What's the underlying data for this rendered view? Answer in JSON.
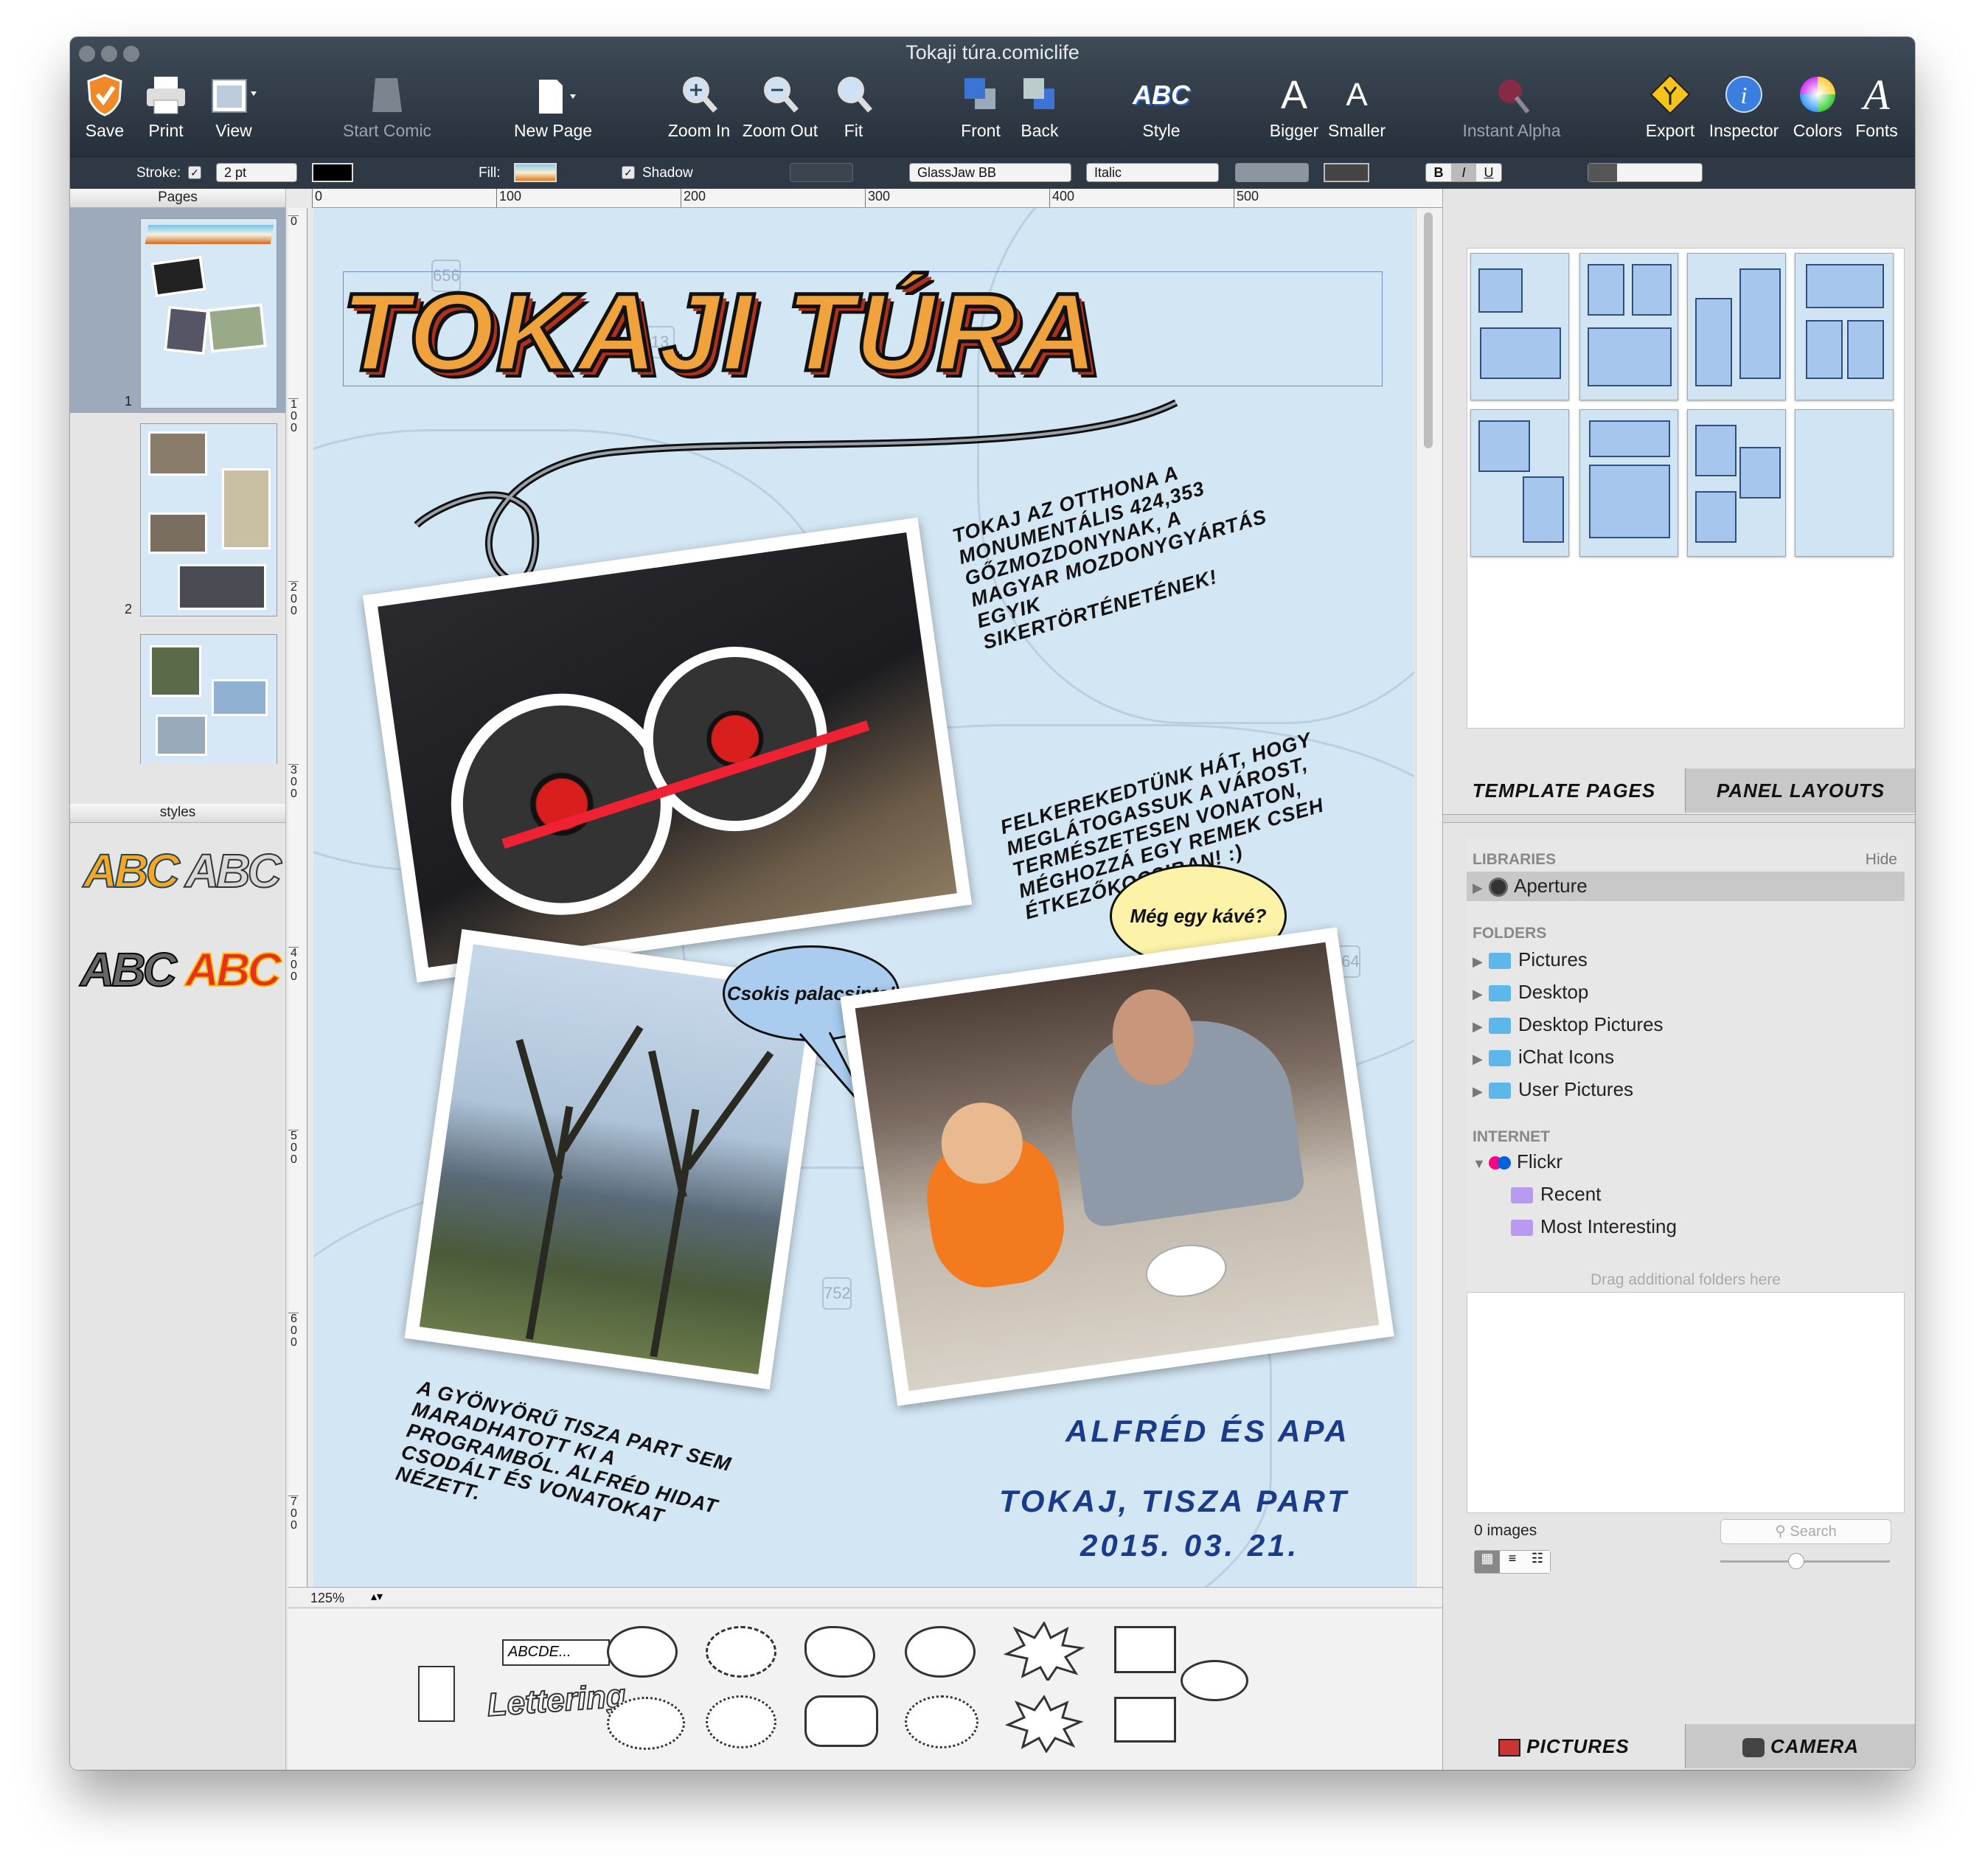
{
  "window": {
    "title": "Tokaji túra.comiclife"
  },
  "toolbar": {
    "save": "Save",
    "print": "Print",
    "view": "View",
    "start_comic": "Start Comic",
    "new_page": "New Page",
    "zoom_in": "Zoom In",
    "zoom_out": "Zoom Out",
    "fit": "Fit",
    "front": "Front",
    "back": "Back",
    "style": "Style",
    "bigger": "Bigger",
    "smaller": "Smaller",
    "instant_alpha": "Instant Alpha",
    "export": "Export",
    "inspector": "Inspector",
    "colors": "Colors",
    "fonts": "Fonts"
  },
  "format_bar": {
    "stroke_label": "Stroke:",
    "stroke_size": "2 pt",
    "fill_label": "Fill:",
    "shadow_label": "Shadow",
    "font": "GlassJaw BB",
    "font_style": "Italic",
    "bold": "B",
    "italic": "I",
    "underline": "U"
  },
  "pages_panel": {
    "title": "Pages",
    "page_numbers": [
      "1",
      "2"
    ]
  },
  "styles_panel": {
    "title": "styles",
    "samples": [
      "ABC",
      "ABC",
      "ABC",
      "ABC"
    ]
  },
  "ruler": {
    "top": [
      "0",
      "100",
      "200",
      "300",
      "400",
      "500"
    ],
    "left": [
      "0",
      "100",
      "200",
      "300",
      "400",
      "500",
      "600",
      "700"
    ]
  },
  "zoom": "125%",
  "comic": {
    "title": "TOKAJI TÚRA",
    "caption1": "Tokaj az otthona a monumentális 424,353 gőzmozdonynak, a magyar mozdonygyártás egyik sikertörténetének!",
    "caption2": "Felkerekedtünk hát, hogy meglátogassuk a várost, természetesen vonaton, méghozzá egy remek cseh étkezőkocsiban! :)",
    "caption3": "A gyönyörű Tisza part sem maradhatott ki a programból. Alfréd hidat csodált és vonatokat nézett.",
    "bubble1": "Még egy kávé?",
    "bubble2": "Csokis palacsinta!",
    "credit1": "ALFRÉD ÉS APA",
    "credit2": "TOKAJ, TISZA PART",
    "credit3": "2015. 03. 21."
  },
  "balloons": {
    "text_box": "ABCDE...",
    "lettering": "Lettering"
  },
  "right_tabs": {
    "template_pages": "TEMPLATE PAGES",
    "panel_layouts": "PANEL LAYOUTS"
  },
  "libraries": {
    "libraries_heading": "LIBRARIES",
    "hide": "Hide",
    "aperture": "Aperture",
    "folders_heading": "FOLDERS",
    "folders": [
      "Pictures",
      "Desktop",
      "Desktop Pictures",
      "iChat Icons",
      "User Pictures"
    ],
    "internet_heading": "INTERNET",
    "flickr": "Flickr",
    "flickr_items": [
      "Recent",
      "Most Interesting"
    ],
    "drag_hint": "Drag additional folders here"
  },
  "images": {
    "count": "0 images",
    "search_placeholder": "Search"
  },
  "bottom_tabs": {
    "pictures": "PICTURES",
    "camera": "CAMERA"
  }
}
